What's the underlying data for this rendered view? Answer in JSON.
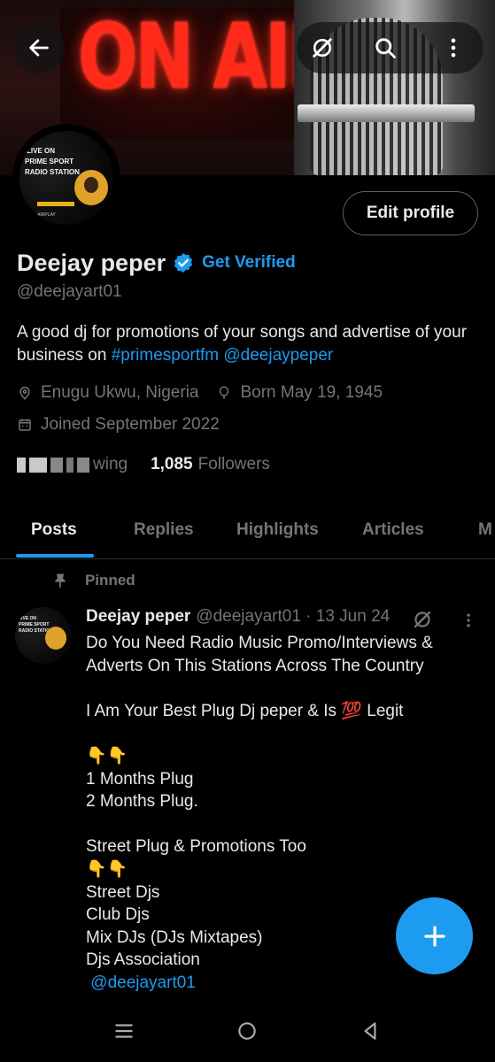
{
  "banner": {
    "image_text": "ON AIR"
  },
  "avatar": {
    "lines": [
      "LIVE ON",
      "PRIME SPORT",
      "RADIO STATION"
    ],
    "footer": "AIRPLAY"
  },
  "profile": {
    "edit_label": "Edit profile",
    "name": "Deejay peper",
    "get_verified": "Get Verified",
    "handle": "@deejayart01",
    "bio_text": "A good dj for promotions of your songs and advertise of your business on ",
    "bio_hashtag": "#primesportfm",
    "bio_mention": "@deejaypeper",
    "location": "Enugu Ukwu, Nigeria",
    "born": "Born May 19, 1945",
    "joined": "Joined September 2022",
    "following_label": "wing",
    "followers_count": "1,085",
    "followers_label": "Followers"
  },
  "tabs": [
    {
      "label": "Posts",
      "active": true
    },
    {
      "label": "Replies",
      "active": false
    },
    {
      "label": "Highlights",
      "active": false
    },
    {
      "label": "Articles",
      "active": false
    },
    {
      "label": "M",
      "active": false
    }
  ],
  "post": {
    "pinned_label": "Pinned",
    "author": "Deejay peper",
    "meta": "@deejayart01 · 13 Jun 24",
    "lines": [
      "Do You Need Radio Music Promo/Interviews &",
      "Adverts On This Stations Across The Country",
      "",
      "I Am Your Best Plug Dj peper & Is 💯 Legit",
      "",
      "👇👇",
      "1 Months Plug",
      "2 Months Plug.",
      "",
      "Street Plug & Promotions Too",
      "👇👇",
      "Street Djs",
      "Club Djs",
      "Mix DJs (DJs Mixtapes)",
      "Djs Association"
    ],
    "mention": "@deejayart01"
  },
  "colors": {
    "accent": "#1d9bf0",
    "background": "#000000",
    "text_primary": "#e7e9ea",
    "text_secondary": "#71767b",
    "divider": "#2f3336"
  },
  "icons": {
    "back": "arrow-left-icon",
    "grok": "grok-icon",
    "search": "search-icon",
    "more": "more-vertical-icon",
    "verified": "verified-badge-icon",
    "location": "location-pin-icon",
    "birthday": "balloon-icon",
    "calendar": "calendar-icon",
    "pin": "pin-icon",
    "compose": "plus-icon",
    "nav_recents": "menu-icon",
    "nav_home": "circle-home-icon",
    "nav_back": "triangle-back-icon"
  }
}
